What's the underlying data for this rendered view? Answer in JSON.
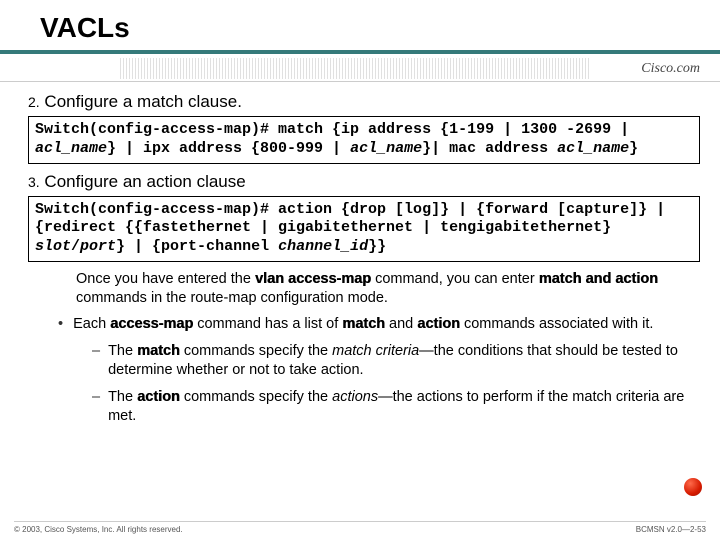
{
  "title": "VACLs",
  "brand": "Cisco.com",
  "step2": {
    "num": "2.",
    "text": "Configure a match clause."
  },
  "code1": {
    "prefix": "Switch(config-access-map)# match {ip address {1-199 | 1300 -2699 | ",
    "i1": "acl_name",
    "mid1": "} | ipx address {800-999 | ",
    "i2": "acl_name",
    "mid2": "}| mac address ",
    "i3": "acl_name",
    "tail": "}"
  },
  "step3": {
    "num": "3.",
    "text": "Configure an action clause"
  },
  "code2": {
    "prefix": "Switch(config-access-map)# action {drop [log]} | {forward [capture]} | {redirect {{fastethernet | gigabitethernet | tengigabitethernet} ",
    "i1": "slot",
    "slash": "/",
    "i2": "port",
    "mid": "} | {port-channel ",
    "i3": "channel_id",
    "tail": "}}"
  },
  "para1": {
    "a": "Once you have entered the ",
    "b1": "vlan access-map",
    "b": " command, you can enter ",
    "b2": "match and action",
    "c": " commands in the route-map configuration mode."
  },
  "bullet": {
    "dot": "•",
    "a": "Each ",
    "b1": "access-map",
    "b": " command has a list of ",
    "b2": "match",
    "c": " and ",
    "b3": "action",
    "d": " commands associated with it."
  },
  "sub1": {
    "dash": "–",
    "a": "The ",
    "b1": "match",
    "b": " commands specify the ",
    "i1": "match criteria",
    "c": "—the conditions that should be tested to determine whether or not to take action."
  },
  "sub2": {
    "dash": "–",
    "a": "The ",
    "b1": "action",
    "b": " commands specify the ",
    "i1": "actions",
    "c": "—the actions to perform if the match criteria are met."
  },
  "footer": {
    "left": "© 2003, Cisco Systems, Inc. All rights reserved.",
    "right": "BCMSN v2.0—2-53"
  }
}
